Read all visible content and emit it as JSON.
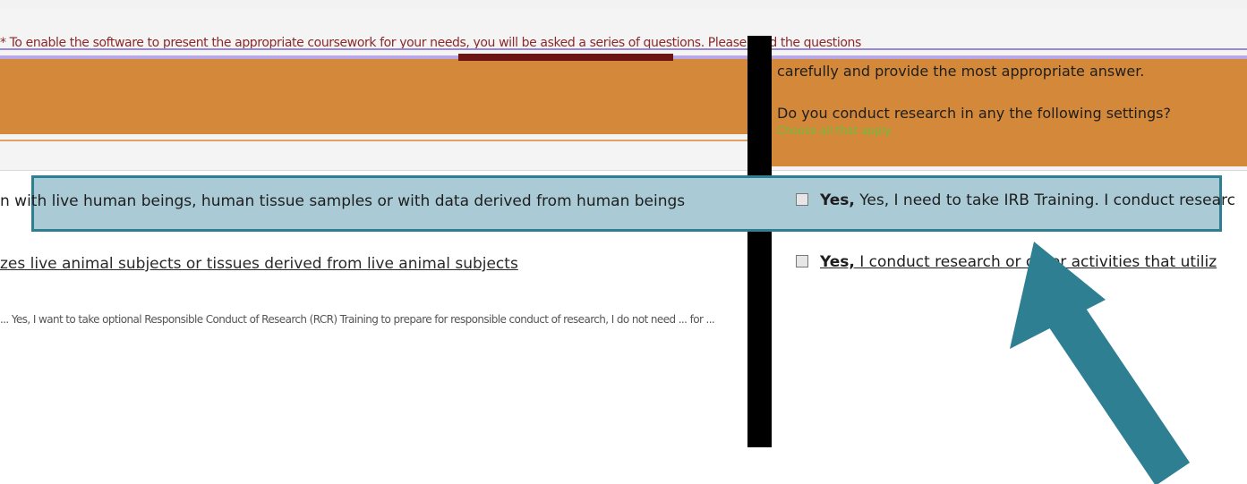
{
  "header": {
    "garbled_line": "* To enable the software to present the appropriate coursework for your needs, you will be asked a series of questions. Please read the questions",
    "instructions": "carefully and provide the most appropriate answer.",
    "question": "Do you conduct research in any the following settings?",
    "hint": "Choose all that apply."
  },
  "rows": [
    {
      "text": "n with live human beings, human tissue samples or with data derived from human beings",
      "answer_bold": "Yes,",
      "answer_rest": " Yes, I need to take IRB Training. I conduct researc"
    },
    {
      "text": "zes live animal subjects or tissues derived from live animal subjects",
      "answer_bold": "Yes,",
      "answer_rest": " I conduct research or other activities that utiliz"
    },
    {
      "text": "... Yes, I want to take optional Responsible Conduct of Research (RCR) Training to prepare for responsible conduct of research, I do not need ... for ..."
    }
  ],
  "colors": {
    "highlight_fill": "#aacbd6",
    "highlight_border": "#2f7f93",
    "arrow": "#2f7f93",
    "band": "#d4893a"
  },
  "icons": {
    "arrow": "arrow-up-left-icon"
  }
}
